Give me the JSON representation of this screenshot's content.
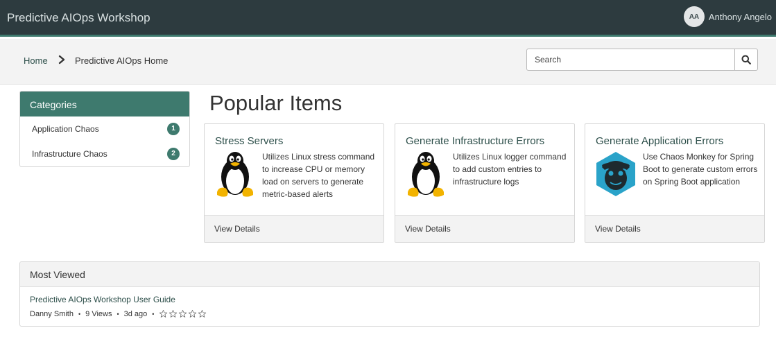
{
  "header": {
    "app_title": "Predictive AIOps Workshop",
    "user_initials": "AA",
    "user_name": "Anthony Angelo"
  },
  "breadcrumb": {
    "home": "Home",
    "current": "Predictive AIOps Home"
  },
  "search": {
    "placeholder": "Search"
  },
  "categories": {
    "title": "Categories",
    "items": [
      {
        "label": "Application Chaos",
        "count": "1"
      },
      {
        "label": "Infrastructure Chaos",
        "count": "2"
      }
    ]
  },
  "popular": {
    "title": "Popular Items",
    "cards": [
      {
        "title": "Stress Servers",
        "icon": "linux-penguin-icon",
        "description": "Utilizes Linux stress command to increase CPU or memory load on servers to generate metric-based alerts",
        "link": "View Details"
      },
      {
        "title": "Generate Infrastructure Errors",
        "icon": "linux-penguin-icon",
        "description": "Utilizes Linux logger command to add custom entries to infrastructure logs",
        "link": "View Details"
      },
      {
        "title": "Generate Application Errors",
        "icon": "chaos-monkey-icon",
        "description": "Use Chaos Monkey for Spring Boot to generate custom errors on Spring Boot application",
        "link": "View Details"
      }
    ]
  },
  "most_viewed": {
    "title": "Most Viewed",
    "items": [
      {
        "title": "Predictive AIOps Workshop User Guide",
        "author": "Danny Smith",
        "views": "9 Views",
        "age": "3d ago",
        "rating": 0,
        "max_rating": 5
      }
    ]
  },
  "colors": {
    "topbar": "#2d3b3f",
    "accent": "#3e7a6e",
    "link": "#2d4f4a"
  }
}
